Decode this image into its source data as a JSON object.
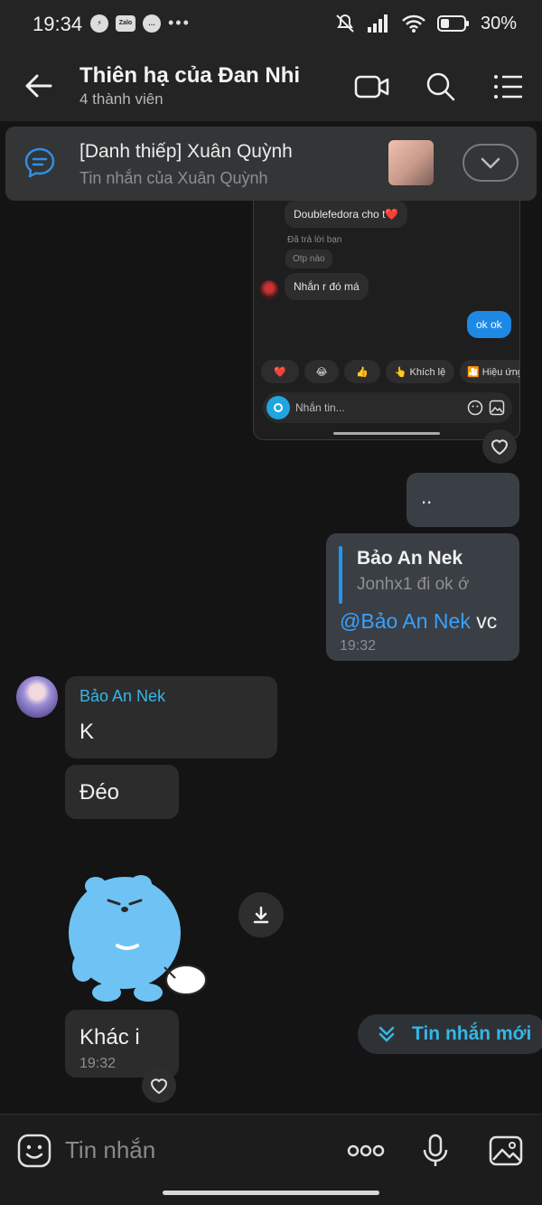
{
  "status_bar": {
    "time": "19:34",
    "battery": "30%",
    "left_icons": [
      "messenger-icon",
      "zalo-icon",
      "chat-icon",
      "more-dots-icon"
    ],
    "zalo_label": "Zalo",
    "more": "•••",
    "right_icons": [
      "mute-icon",
      "signal-icon",
      "wifi-icon",
      "battery-icon"
    ]
  },
  "header": {
    "title": "Thiên hạ của Đan Nhi",
    "subtitle": "4 thành viên",
    "icons": [
      "back-arrow-icon",
      "video-call-icon",
      "search-icon",
      "menu-list-icon"
    ]
  },
  "pinned": {
    "title": "[Danh thiếp] Xuân Quỳnh",
    "subtitle": "Tin nhắn của Xuân Quỳnh"
  },
  "shared_screenshot": {
    "bubble1": "Doublefedora cho t❤️",
    "replied_note": "Đã trả lời bạn",
    "quoted_chip": "Otp nào",
    "bubble2": "Nhắn r đó má",
    "mine_bubble": "ok ok",
    "reactions": [
      "❤️",
      "😂",
      "👍",
      "👆 Khích lệ",
      "🎦 Hiệu ứng"
    ],
    "input_placeholder": "Nhắn tin..."
  },
  "messages": {
    "dots": "..",
    "reply_msg": {
      "quote_name": "Bảo An Nek",
      "quote_text": "Jonhx1 đi ok ớ",
      "mention": "@Bảo An Nek",
      "text": " vc",
      "time": "19:32"
    },
    "sender_name": "Bảo An Nek",
    "msg_k": "K",
    "msg_deo": "Đéo",
    "msg_khac": "Khác i",
    "msg_khac_time": "19:32"
  },
  "new_messages_button": "Tin nhắn mới",
  "composer": {
    "placeholder": "Tin nhắn",
    "icons": [
      "sticker-icon",
      "more-options-icon",
      "microphone-icon",
      "gallery-icon"
    ]
  }
}
